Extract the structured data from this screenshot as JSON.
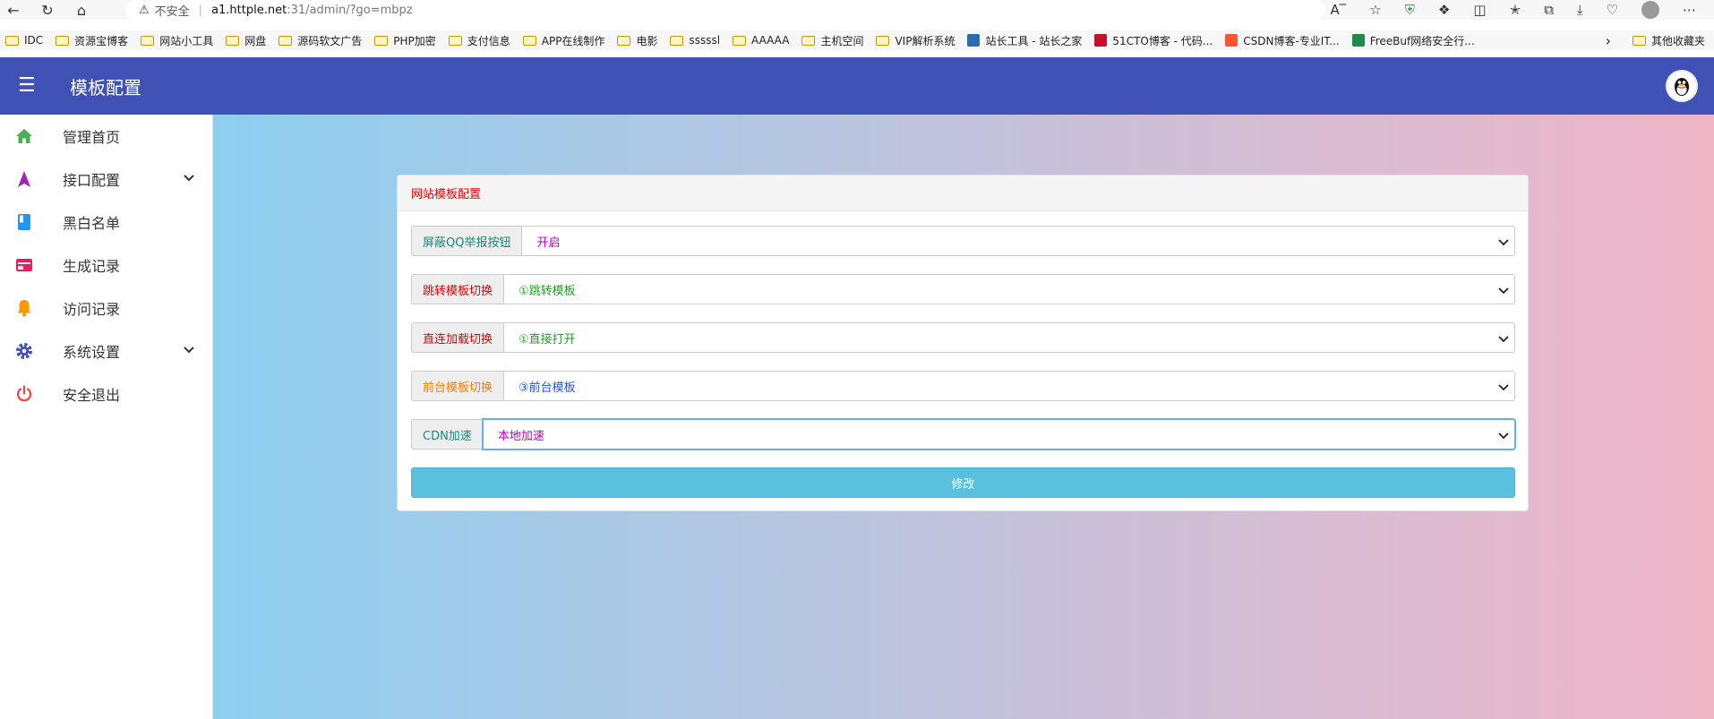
{
  "browser": {
    "security_label": "不安全",
    "url_host": "a1.httple.net",
    "url_path": ":31/admin/?go=mbpz",
    "bookmarks": [
      {
        "label": "IDC",
        "type": "folder"
      },
      {
        "label": "资源宝博客",
        "type": "folder"
      },
      {
        "label": "网站小工具",
        "type": "folder"
      },
      {
        "label": "网盘",
        "type": "folder"
      },
      {
        "label": "源码软文广告",
        "type": "folder"
      },
      {
        "label": "PHP加密",
        "type": "folder"
      },
      {
        "label": "支付信息",
        "type": "folder"
      },
      {
        "label": "APP在线制作",
        "type": "folder"
      },
      {
        "label": "电影",
        "type": "folder"
      },
      {
        "label": "sssssl",
        "type": "folder"
      },
      {
        "label": "AAAAA",
        "type": "folder"
      },
      {
        "label": "主机空间",
        "type": "folder"
      },
      {
        "label": "VIP解析系统",
        "type": "folder"
      },
      {
        "label": "站长工具 - 站长之家",
        "type": "site",
        "color": "#2b6cb0"
      },
      {
        "label": "51CTO博客 - 代码...",
        "type": "site",
        "color": "#c8102e"
      },
      {
        "label": "CSDN博客-专业IT...",
        "type": "site",
        "color": "#fc5531"
      },
      {
        "label": "FreeBuf网络安全行...",
        "type": "site",
        "color": "#1f8a4c"
      }
    ],
    "other_bookmarks": "其他收藏夹"
  },
  "header": {
    "title": "模板配置"
  },
  "sidebar": {
    "items": [
      {
        "label": "管理首页",
        "icon": "home-icon",
        "color": "#4caf50"
      },
      {
        "label": "接口配置",
        "icon": "navigation-icon",
        "color": "#9c27b0",
        "expandable": true
      },
      {
        "label": "黑白名单",
        "icon": "book-icon",
        "color": "#2196f3"
      },
      {
        "label": "生成记录",
        "icon": "card-icon",
        "color": "#e91e63"
      },
      {
        "label": "访问记录",
        "icon": "bell-icon",
        "color": "#ff9800"
      },
      {
        "label": "系统设置",
        "icon": "gear-icon",
        "color": "#3f51b5",
        "expandable": true
      },
      {
        "label": "安全退出",
        "icon": "power-icon",
        "color": "#f44336"
      }
    ]
  },
  "panel": {
    "title": "网站模板配置",
    "rows": [
      {
        "label": "屏蔽QQ举报按钮",
        "label_color": "#1a8a7a",
        "value": "开启",
        "value_color": "#c000c0"
      },
      {
        "label": "跳转模板切换",
        "label_color": "#e00000",
        "value": "①跳转模板",
        "value_color": "#22a022"
      },
      {
        "label": "直连加载切换",
        "label_color": "#e00000",
        "value": "①直接打开",
        "value_color": "#22a022"
      },
      {
        "label": "前台模板切换",
        "label_color": "#f08000",
        "value": "③前台模板",
        "value_color": "#2255dd"
      },
      {
        "label": "CDN加速",
        "label_color": "#1a8a7a",
        "value": "本地加速",
        "value_color": "#c000c0"
      }
    ],
    "submit_label": "修改"
  }
}
